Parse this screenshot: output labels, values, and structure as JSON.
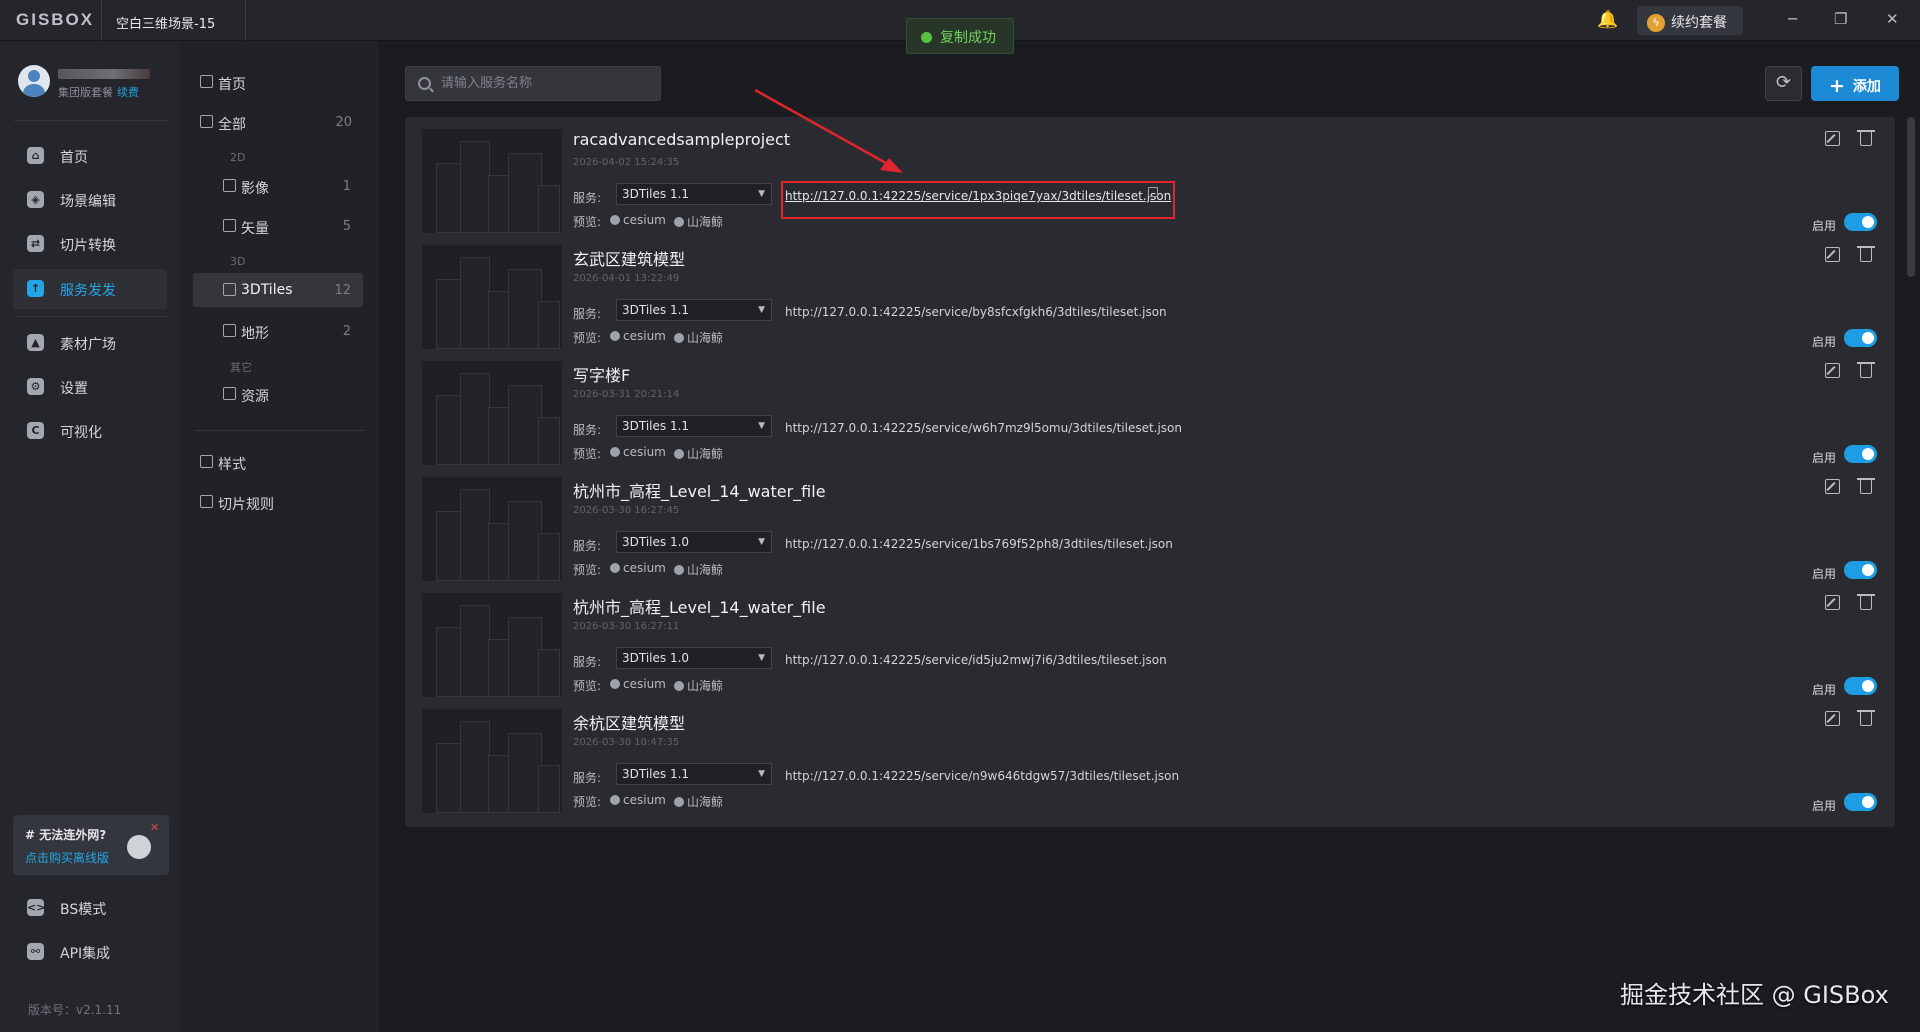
{
  "app": {
    "logo": "GISBOX",
    "window_tab": "空白三维场景-15"
  },
  "toast": {
    "text": "复制成功",
    "icon": "check-circle-icon",
    "color": "#5ac143"
  },
  "header": {
    "bell_icon": "bell-icon",
    "renew_label": "续约套餐",
    "renew_icon": "lightning-icon",
    "window_controls": {
      "minimize": "─",
      "restore": "❐",
      "close": "✕"
    }
  },
  "user": {
    "plan": "集团版套餐",
    "renew_link": "续费"
  },
  "left_nav": {
    "items": [
      {
        "label": "首页",
        "icon": "home-icon",
        "glyph": "⌂"
      },
      {
        "label": "场景编辑",
        "icon": "cube-icon",
        "glyph": "◈"
      },
      {
        "label": "切片转换",
        "icon": "convert-icon",
        "glyph": "⇄"
      },
      {
        "label": "服务发发",
        "icon": "cloud-upload-icon",
        "glyph": "↑"
      },
      {
        "label": "素材广场",
        "icon": "image-icon",
        "glyph": "▲"
      },
      {
        "label": "设置",
        "icon": "gear-icon",
        "glyph": "⚙"
      },
      {
        "label": "可视化",
        "icon": "chart-icon",
        "glyph": "C"
      }
    ],
    "offline_title": "# 无法连外网?",
    "offline_link": "点击购买离线版",
    "bottom": [
      {
        "label": "BS模式",
        "icon": "code-icon",
        "glyph": "<>"
      },
      {
        "label": "API集成",
        "icon": "api-icon",
        "glyph": "⚯"
      }
    ],
    "version": "版本号：v2.1.11"
  },
  "sub_nav": {
    "home": "首页",
    "all": {
      "label": "全部",
      "count": "20"
    },
    "group_2d": "2D",
    "imagery": {
      "label": "影像",
      "count": "1"
    },
    "vector": {
      "label": "矢量",
      "count": "5"
    },
    "group_3d": "3D",
    "tiles": {
      "label": "3DTiles",
      "count": "12"
    },
    "terrain": {
      "label": "地形",
      "count": "2"
    },
    "group_other": "其它",
    "resource": {
      "label": "资源"
    },
    "style": "样式",
    "tile_rules": "切片规则"
  },
  "toolbar": {
    "search_placeholder": "请输入服务名称",
    "refresh_icon": "refresh-icon",
    "add_label": "添加"
  },
  "cards": [
    {
      "title": "racadvancedsampleproject",
      "time": "2026-04-02 15:24:35",
      "service_label": "服务:",
      "service": "3DTiles 1.1",
      "url": "http://127.0.0.1:42225/service/1px3piqe7yax/3dtiles/tileset.json",
      "preview_label": "预览:",
      "preview_cesium": "cesium",
      "preview_shj": "山海鲸",
      "enable_label": "启用",
      "enabled": true
    },
    {
      "title": "玄武区建筑模型",
      "time": "2026-04-01 13:22:49",
      "service_label": "服务:",
      "service": "3DTiles 1.1",
      "url": "http://127.0.0.1:42225/service/by8sfcxfgkh6/3dtiles/tileset.json",
      "preview_label": "预览:",
      "preview_cesium": "cesium",
      "preview_shj": "山海鲸",
      "enable_label": "启用",
      "enabled": true
    },
    {
      "title": "写字楼F",
      "time": "2026-03-31 20:21:14",
      "service_label": "服务:",
      "service": "3DTiles 1.1",
      "url": "http://127.0.0.1:42225/service/w6h7mz9l5omu/3dtiles/tileset.json",
      "preview_label": "预览:",
      "preview_cesium": "cesium",
      "preview_shj": "山海鲸",
      "enable_label": "启用",
      "enabled": true
    },
    {
      "title": "杭州市_高程_Level_14_water_file",
      "time": "2026-03-30 16:27:45",
      "service_label": "服务:",
      "service": "3DTiles 1.0",
      "url": "http://127.0.0.1:42225/service/1bs769f52ph8/3dtiles/tileset.json",
      "preview_label": "预览:",
      "preview_cesium": "cesium",
      "preview_shj": "山海鲸",
      "enable_label": "启用",
      "enabled": true
    },
    {
      "title": "杭州市_高程_Level_14_water_file",
      "time": "2026-03-30 16:27:11",
      "service_label": "服务:",
      "service": "3DTiles 1.0",
      "url": "http://127.0.0.1:42225/service/id5ju2mwj7i6/3dtiles/tileset.json",
      "preview_label": "预览:",
      "preview_cesium": "cesium",
      "preview_shj": "山海鲸",
      "enable_label": "启用",
      "enabled": true
    },
    {
      "title": "余杭区建筑模型",
      "time": "2026-03-30 10:47:35",
      "service_label": "服务:",
      "service": "3DTiles 1.1",
      "url": "http://127.0.0.1:42225/service/n9w646tdgw57/3dtiles/tileset.json",
      "preview_label": "预览:",
      "preview_cesium": "cesium",
      "preview_shj": "山海鲸",
      "enable_label": "启用",
      "enabled": true
    }
  ],
  "annotation_color": "#e0262c",
  "watermark": "掘金技术社区 @ GISBox"
}
